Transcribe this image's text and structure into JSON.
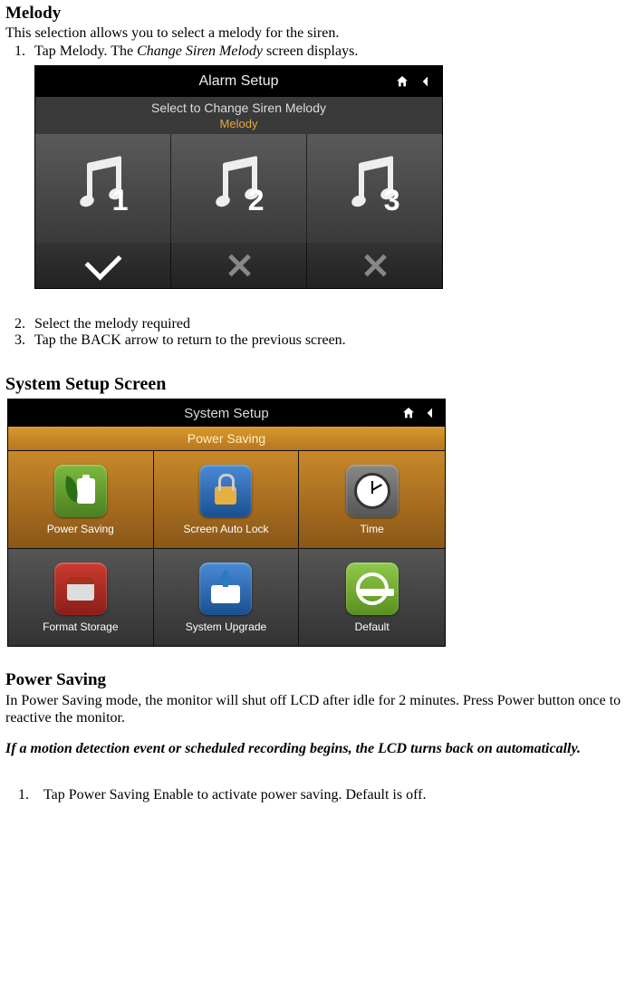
{
  "section1": {
    "title": "Melody",
    "desc": "This selection allows you to select a melody for the siren.",
    "step1_num": "1.",
    "step1_a": "Tap Melody. The ",
    "step1_em": "Change Siren Melody",
    "step1_b": " screen displays."
  },
  "alarm_screen": {
    "title": "Alarm Setup",
    "subtitle1": "Select to Change Siren Melody",
    "subtitle2": "Melody",
    "opt1": "1",
    "opt2": "2",
    "opt3": "3"
  },
  "section1b": {
    "step2_num": "2.",
    "step2": "Select the melody required",
    "step3_num": "3.",
    "step3": "Tap the BACK arrow to return to the previous screen."
  },
  "section2": {
    "title": "System Setup Screen"
  },
  "system_screen": {
    "title": "System Setup",
    "subtitle": "Power Saving",
    "items": [
      "Power Saving",
      "Screen Auto Lock",
      "Time",
      "Format Storage",
      "System Upgrade",
      "Default"
    ]
  },
  "section3": {
    "title": "Power Saving",
    "desc": "In Power Saving mode, the monitor will shut off LCD after idle for 2 minutes. Press Power button once to reactive the monitor.",
    "note": "If a motion detection event or scheduled recording begins, the LCD turns back on automatically.",
    "step1_num": "1.",
    "step1": "Tap Power Saving Enable to activate power saving. Default is off."
  }
}
